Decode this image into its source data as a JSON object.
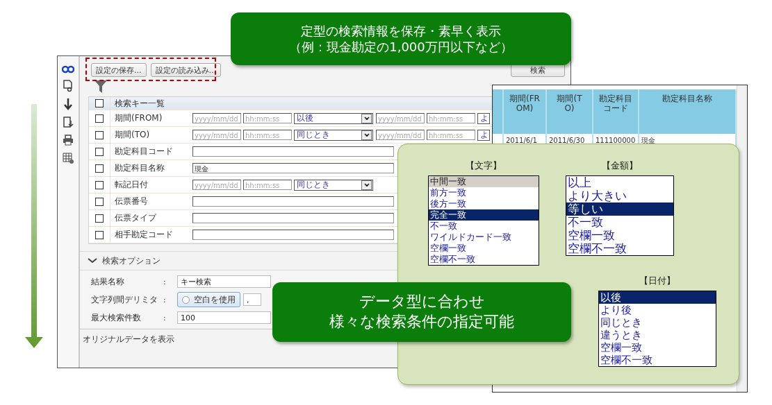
{
  "callout_top": {
    "lines": [
      "定型の検索情報を保存・素早く表示",
      "（例：現金勘定の1,000万円以下など）"
    ]
  },
  "main_window": {
    "toolbar_buttons": [
      "設定の保存...",
      "設定の読み込み..."
    ],
    "search_button": "検索",
    "key_table": {
      "header": "検索キー一覧",
      "header_checked": false,
      "rows": [
        {
          "label": "期間(FROM)",
          "checked": false,
          "kind": "datetime",
          "date_placeholder": "yyyy/mm/dd",
          "time_placeholder": "hh:mm:ss",
          "operator": "以後",
          "end_date_placeholder": "yyyy/mm/dd",
          "end_time_placeholder": "hh:mm:ss",
          "end_operator": "よ"
        },
        {
          "label": "期間(TO)",
          "checked": false,
          "kind": "datetime",
          "date_placeholder": "yyyy/mm/dd",
          "time_placeholder": "hh:mm:ss",
          "operator": "同じとき",
          "end_date_placeholder": "yyyy/mm/dd",
          "end_time_placeholder": "hh:mm:ss",
          "end_operator": "よ"
        },
        {
          "label": "勘定科目コード",
          "checked": false,
          "kind": "text"
        },
        {
          "label": "勘定科目名称",
          "checked": false,
          "kind": "text",
          "value": "現金"
        },
        {
          "label": "転記日付",
          "checked": false,
          "kind": "datetime",
          "date_placeholder": "yyyy/mm/dd",
          "time_placeholder": "hh:mm:ss",
          "operator": "同じとき"
        },
        {
          "label": "伝票番号",
          "checked": false,
          "kind": "text"
        },
        {
          "label": "伝票タイプ",
          "checked": false,
          "kind": "text"
        },
        {
          "label": "相手勘定コード",
          "checked": false,
          "kind": "text"
        }
      ]
    },
    "options_section": {
      "title": "検索オプション",
      "expanded": true,
      "fields": [
        {
          "label": "結果名称",
          "separator": ":",
          "kind": "text",
          "value": "キー検索"
        },
        {
          "label": "文字列間デリミタ",
          "separator": ":",
          "kind": "delimiter",
          "toggle": "空白を使用",
          "toggle_on": false,
          "value": ","
        },
        {
          "label": "最大検索件数",
          "separator": ":",
          "kind": "text",
          "value": "100"
        }
      ]
    },
    "footer": "オリジナルデータを表示"
  },
  "results_window": {
    "columns": [
      "期間(FROM)",
      "期間(TO)",
      "勘定科目コード",
      "勘定科目名称"
    ],
    "rows": [
      [
        "2011/6/1",
        "2011/6/30",
        "111100000",
        "現金"
      ]
    ]
  },
  "condition_lists": [
    {
      "title": "【文字】",
      "items": [
        {
          "label": "中間一致",
          "selected": false,
          "hovered": true
        },
        {
          "label": "前方一致",
          "selected": false,
          "hovered": false
        },
        {
          "label": "後方一致",
          "selected": false,
          "hovered": false
        },
        {
          "label": "完全一致",
          "selected": true,
          "hovered": false
        },
        {
          "label": "不一致",
          "selected": false,
          "hovered": false
        },
        {
          "label": "ワイルドカード一致",
          "selected": false,
          "hovered": false
        },
        {
          "label": "空欄一致",
          "selected": false,
          "hovered": false
        },
        {
          "label": "空欄不一致",
          "selected": false,
          "hovered": false
        }
      ]
    },
    {
      "title": "【金額】",
      "items": [
        {
          "label": "以上",
          "selected": false,
          "hovered": false
        },
        {
          "label": "より大きい",
          "selected": false,
          "hovered": false
        },
        {
          "label": "等しい",
          "selected": true,
          "hovered": false
        },
        {
          "label": "不一致",
          "selected": false,
          "hovered": false
        },
        {
          "label": "空欄一致",
          "selected": false,
          "hovered": false
        },
        {
          "label": "空欄不一致",
          "selected": false,
          "hovered": false
        }
      ]
    },
    {
      "title": "【日付】",
      "items": [
        {
          "label": "以後",
          "selected": true,
          "hovered": false
        },
        {
          "label": "より後",
          "selected": false,
          "hovered": false
        },
        {
          "label": "同じとき",
          "selected": false,
          "hovered": false
        },
        {
          "label": "違うとき",
          "selected": false,
          "hovered": false
        },
        {
          "label": "空欄一致",
          "selected": false,
          "hovered": false
        },
        {
          "label": "空欄不一致",
          "selected": false,
          "hovered": false
        }
      ]
    }
  ],
  "callout_bottom": {
    "lines": [
      "データ型に合わせ",
      "様々な検索条件の指定可能"
    ]
  }
}
